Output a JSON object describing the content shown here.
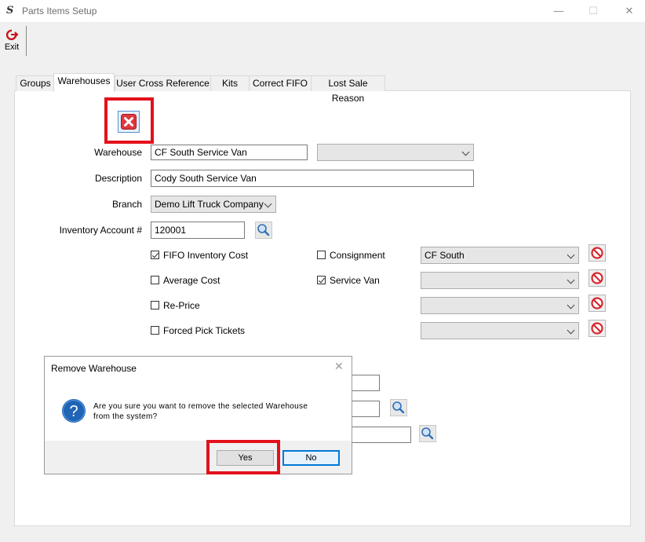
{
  "window": {
    "title": "Parts Items Setup",
    "minimize": "—",
    "maximize": "☐",
    "close": "✕"
  },
  "toolbar": {
    "exit_label": "Exit"
  },
  "tabs": [
    "Groups",
    "Warehouses",
    "User Cross Reference",
    "Kits",
    "Correct FIFO",
    "Lost Sale Reason"
  ],
  "form": {
    "warehouse_label": "Warehouse",
    "warehouse_value": "CF South Service Van",
    "warehouse_select_value": "",
    "description_label": "Description",
    "description_value": "Cody South Service Van",
    "branch_label": "Branch",
    "branch_value": "Demo Lift Truck Company",
    "inventory_account_label": "Inventory Account #",
    "inventory_account_value": "120001"
  },
  "options": {
    "fifo": {
      "label": "FIFO Inventory Cost",
      "checked": true
    },
    "average_cost": {
      "label": "Average Cost",
      "checked": false
    },
    "reprice": {
      "label": "Re-Price",
      "checked": false
    },
    "forced_pick": {
      "label": "Forced Pick Tickets",
      "checked": false
    },
    "consignment": {
      "label": "Consignment",
      "checked": false,
      "select_value": "CF South"
    },
    "service_van": {
      "label": "Service Van",
      "checked": true,
      "select_value": ""
    },
    "row3_select_value": "",
    "row4_select_value": ""
  },
  "dialog": {
    "title": "Remove Warehouse",
    "message_line1": "Are you sure you want to remove the selected Warehouse",
    "message_line2": "from the system?",
    "yes_label": "Yes",
    "no_label": "No"
  },
  "colors": {
    "highlight": "#e3111b",
    "accent": "#0078d7",
    "delete_red": "#d9262e"
  }
}
